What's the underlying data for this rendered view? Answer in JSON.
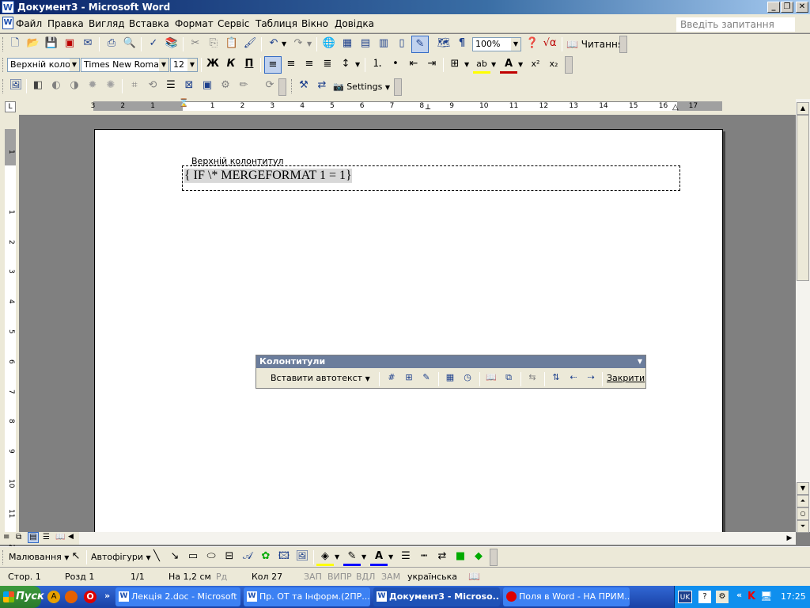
{
  "window": {
    "title": "Документ3 - Microsoft Word",
    "app_icon": "W",
    "min_glyph": "_",
    "max_glyph": "❐",
    "close_glyph": "✕",
    "doc_min_glyph": "_",
    "doc_restore_glyph": "❐",
    "doc_close_glyph": "✕"
  },
  "menu": {
    "items": [
      "Файл",
      "Правка",
      "Вигляд",
      "Вставка",
      "Формат",
      "Сервіс",
      "Таблиця",
      "Вікно",
      "Довідка"
    ],
    "ask_placeholder": "Введіть запитання",
    "ask_close": "✕"
  },
  "standard_toolbar": {
    "zoom": "100%",
    "reading_label": "Читання",
    "paragraph_mark": "¶"
  },
  "formatting_toolbar": {
    "style": "Верхній колонт",
    "font": "Times New Roman",
    "size": "12",
    "bold": "Ж",
    "italic": "К",
    "underline": "П",
    "superscript": "x²",
    "subscript": "x₂",
    "font_color_glyph": "A",
    "highlight_glyph": "ab"
  },
  "picture_toolbar": {
    "settings_label": "Settings"
  },
  "ruler": {
    "h_numbers": [
      "3",
      "2",
      "1",
      "1",
      "2",
      "3",
      "4",
      "5",
      "6",
      "7",
      "8",
      "9",
      "10",
      "11",
      "12",
      "13",
      "14",
      "15",
      "16",
      "17"
    ],
    "v_numbers": [
      "1",
      "1",
      "2",
      "3",
      "4",
      "5",
      "6",
      "7",
      "8",
      "9",
      "10",
      "11",
      "12"
    ]
  },
  "document": {
    "header_label": "Верхній колонтитул",
    "field_code": "{ IF  \\* MERGEFORMAT 1 = 1}"
  },
  "header_footer_toolbar": {
    "caption": "Колонтитули",
    "insert_autotext": "Вставити автотекст",
    "close_label": "Закрити"
  },
  "drawing_toolbar": {
    "drawing_label": "Малювання",
    "autoshapes_label": "Автофігури"
  },
  "status": {
    "page": "Стор.  1",
    "section": "Розд  1",
    "pages": "1/1",
    "at": "На  1,2 см",
    "line": "Рд",
    "col": "Кол  27",
    "rec": "ЗАП",
    "trk": "ВИПР",
    "ext": "ВДЛ",
    "ovr": "ЗАМ",
    "language": "українська"
  },
  "taskbar": {
    "start": "Пуск",
    "tasks": [
      {
        "label": "Лекція 2.doc - Microsoft ...",
        "active": false
      },
      {
        "label": "Пр. ОТ та Інформ.(2ПР...",
        "active": false
      },
      {
        "label": "Документ3 - Microso...",
        "active": true
      },
      {
        "label": "Поля в Word - НА ПРИМ...",
        "active": false
      }
    ],
    "quicklaunch_more": "»",
    "tray_lang": "UK",
    "tray_arrows": "«",
    "clock": "17:25"
  },
  "colors": {
    "titlebar": "#0a246a",
    "toolbar_bg": "#ece9d8",
    "doc_bg": "#808080",
    "taskbar": "#3168d5",
    "start": "#3c9a3c"
  }
}
